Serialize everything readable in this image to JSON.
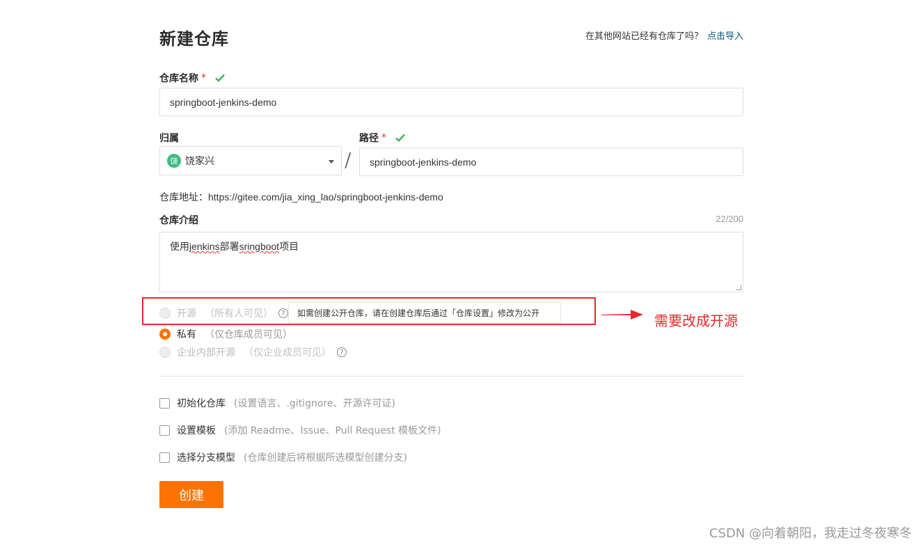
{
  "page": {
    "title": "新建仓库",
    "import_text": "在其他网站已经有仓库了吗？",
    "import_link": "点击导入"
  },
  "repo_name": {
    "label": "仓库名称",
    "required_mark": "*",
    "value": "springboot-jenkins-demo"
  },
  "owner": {
    "label": "归属",
    "avatar_char": "饶",
    "value": "饶家兴"
  },
  "path": {
    "label": "路径",
    "required_mark": "*",
    "separator": "/",
    "value": "springboot-jenkins-demo"
  },
  "address": {
    "label": "仓库地址：",
    "value": "https://gitee.com/jia_xing_lao/springboot-jenkins-demo"
  },
  "description": {
    "label": "仓库介绍",
    "counter": "22/200",
    "value_prefix": "使用",
    "value_word1": "jenkins",
    "value_mid": "部署",
    "value_word2": "sringboot",
    "value_suffix": "项目"
  },
  "visibility": {
    "options": [
      {
        "label": "开源",
        "hint": "（所有人可见）",
        "selected": false,
        "disabled": true
      },
      {
        "label": "私有",
        "hint": "（仅仓库成员可见）",
        "selected": true,
        "disabled": false
      },
      {
        "label": "企业内部开源",
        "hint": "（仅企业成员可见）",
        "selected": false,
        "disabled": true
      }
    ],
    "tooltip": "如需创建公开仓库，请在创建仓库后通过「仓库设置」修改为公开"
  },
  "annotation": {
    "text": "需要改成开源",
    "color": "#e8282a"
  },
  "options": [
    {
      "label": "初始化仓库",
      "hint": "(设置语言、.gitignore、开源许可证)"
    },
    {
      "label": "设置模板",
      "hint": "(添加 Readme、Issue、Pull Request 模板文件)"
    },
    {
      "label": "选择分支模型",
      "hint": "(仓库创建后将根据所选模型创建分支)"
    }
  ],
  "submit": {
    "label": "创建"
  },
  "watermark": "CSDN @向着朝阳，我走过冬夜寒冬",
  "colors": {
    "accent": "#fe7300",
    "link": "#005980",
    "success": "#3dbd7d",
    "annotation": "#e8282a"
  }
}
